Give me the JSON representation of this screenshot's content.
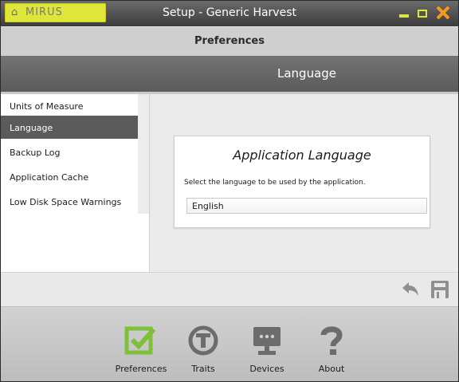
{
  "window": {
    "brand": "MIRUS",
    "title": "Setup - Generic Harvest",
    "accent": "#dfe63a",
    "close_color": "#f39b1d"
  },
  "section_bar": {
    "title": "Preferences"
  },
  "panel_header": {
    "title": "Language"
  },
  "sidebar": {
    "items": [
      {
        "label": "Units of Measure",
        "selected": false
      },
      {
        "label": "Language",
        "selected": true
      },
      {
        "label": "Backup Log",
        "selected": false
      },
      {
        "label": "Application Cache",
        "selected": false
      },
      {
        "label": "Low Disk Space Warnings",
        "selected": false
      }
    ]
  },
  "card": {
    "title": "Application Language",
    "description": "Select the language to be used by the application.",
    "language_select": {
      "value": "English"
    }
  },
  "toolbar": {
    "icons": [
      "undo-icon",
      "save-icon"
    ]
  },
  "bottom_nav": {
    "items": [
      {
        "label": "Preferences",
        "icon": "checkbox-icon",
        "color": "#7fbf3a"
      },
      {
        "label": "Traits",
        "icon": "trait-icon",
        "color": "#6c6c6c"
      },
      {
        "label": "Devices",
        "icon": "monitor-icon",
        "color": "#6c6c6c"
      },
      {
        "label": "About",
        "icon": "question-icon",
        "color": "#6c6c6c"
      }
    ]
  }
}
